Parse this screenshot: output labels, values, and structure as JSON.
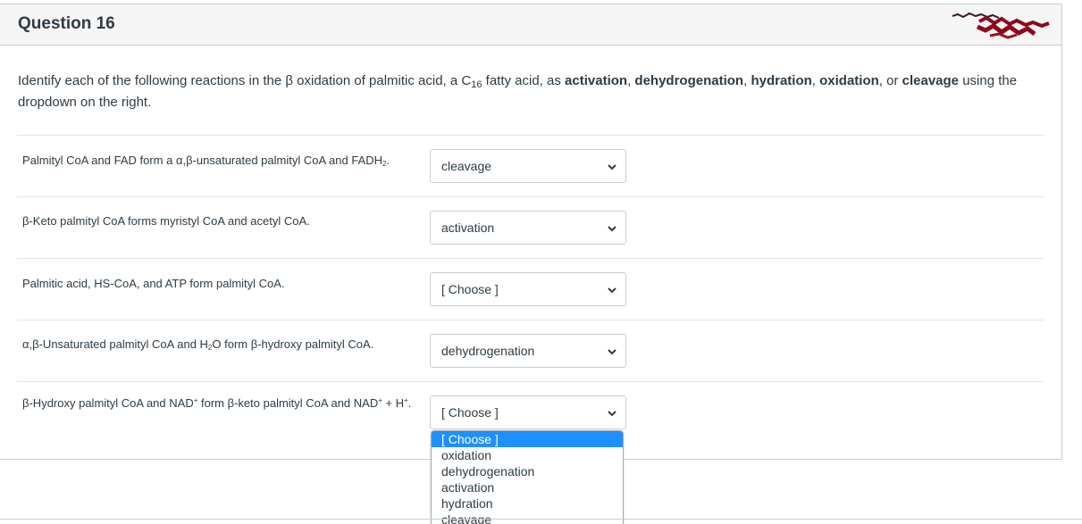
{
  "question": {
    "title": "Question 16",
    "intro_part1": "Identify each of the following reactions in the β oxidation of palmitic acid, a C",
    "intro_sub": "16",
    "intro_part2": " fatty acid, as ",
    "term_activation": "activation",
    "comma1": ", ",
    "term_dehydrogenation": "dehydrogenation",
    "comma2": ", ",
    "term_hydration": "hydration",
    "comma3": ", ",
    "term_oxidation": "oxidation",
    "or_text": ", or ",
    "term_cleavage": "cleavage",
    "intro_part3": " using the dropdown on the right."
  },
  "rows": [
    {
      "stmt_a": "Palmityl CoA and FAD form a α,β-unsaturated palmityl CoA and FADH",
      "stmt_sub": "2",
      "stmt_b": ".",
      "selected": "cleavage"
    },
    {
      "stmt": "β-Keto palmityl CoA forms myristyl CoA and acetyl CoA.",
      "selected": "activation"
    },
    {
      "stmt": "Palmitic acid, HS-CoA, and ATP form palmityl CoA.",
      "selected": "[ Choose ]"
    },
    {
      "stmt_a": "α,β-Unsaturated palmityl CoA and H",
      "stmt_sub": "2",
      "stmt_b": "O form β-hydroxy palmityl CoA.",
      "selected": "dehydrogenation"
    },
    {
      "stmt_a": "β-Hydroxy palmityl CoA and NAD",
      "stmt_sup1": "+",
      "stmt_b": " form β-keto palmityl CoA and NAD",
      "stmt_sup2": "+",
      "stmt_c": " + H",
      "stmt_sup3": "+",
      "stmt_d": ".",
      "selected": "[ Choose ]"
    }
  ],
  "dropdown_options": [
    "[ Choose ]",
    "oxidation",
    "dehydrogenation",
    "activation",
    "hydration",
    "cleavage"
  ],
  "dropdown_highlighted_index": 0,
  "icons": {
    "select_arrow": "chevron-down-icon",
    "annotation": "scribble-mark"
  },
  "colors": {
    "highlight": "#1e90ff",
    "text": "#2d3b45",
    "border": "#c7cdd1",
    "header_bg": "#f5f5f5",
    "scribble": "#8b0a1a"
  }
}
